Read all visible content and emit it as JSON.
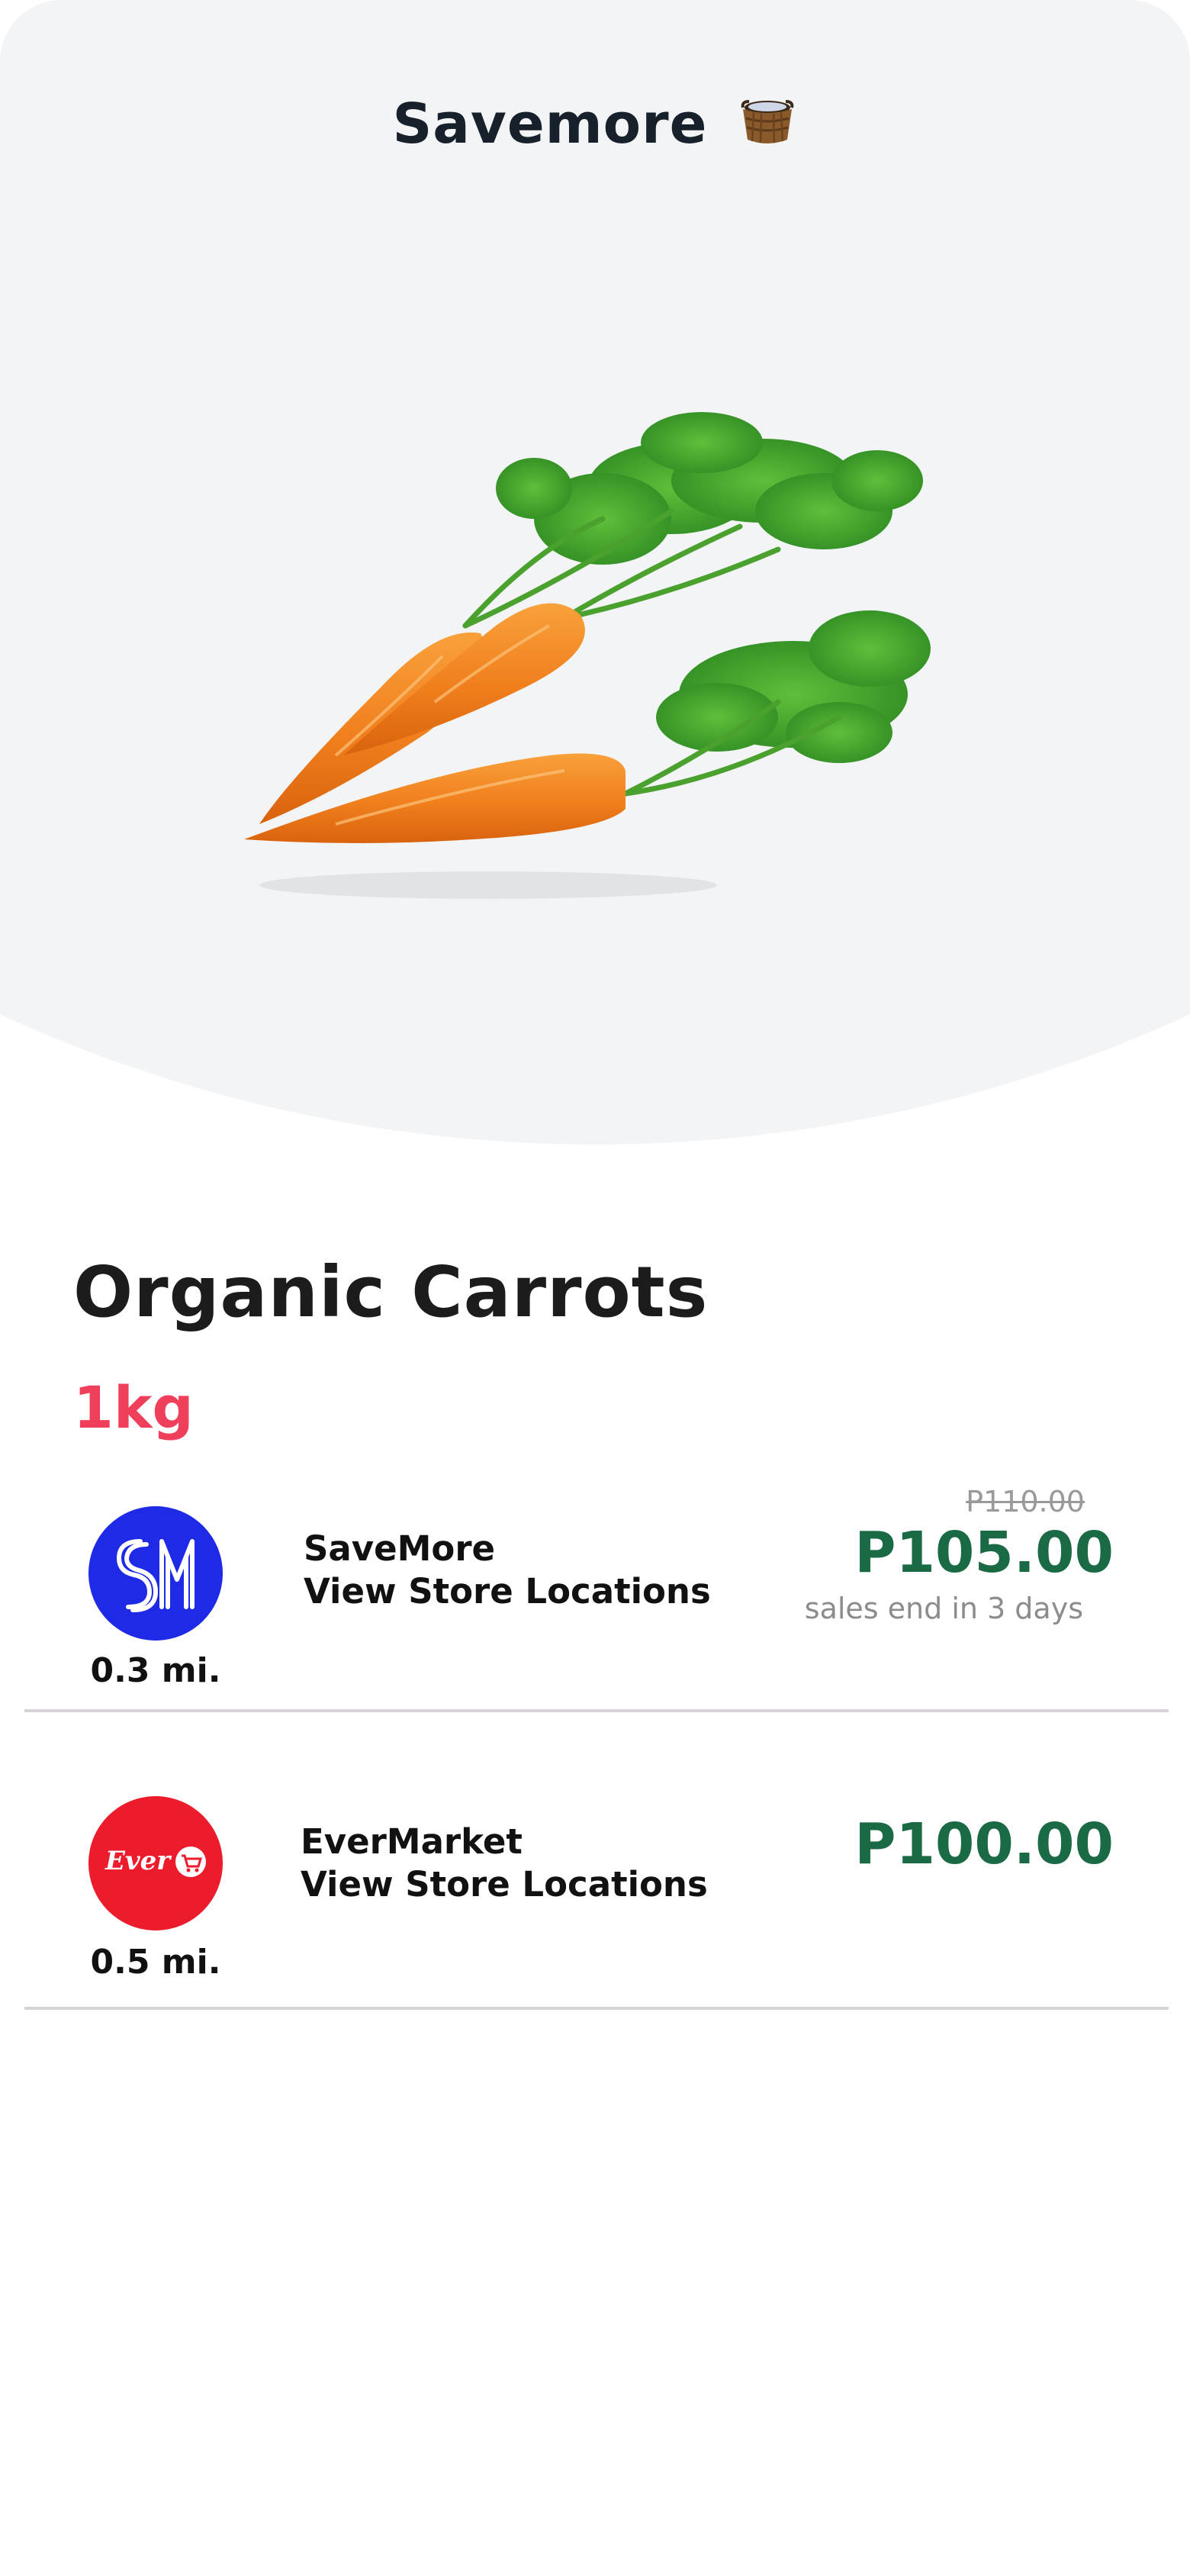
{
  "header": {
    "title": "Savemore",
    "icon": "basket-icon"
  },
  "product": {
    "name": "Organic Carrots",
    "weight": "1kg",
    "image": "carrots-image"
  },
  "stores": [
    {
      "name": "SaveMore",
      "link_label": "View Store Locations",
      "distance": "0.3 mi.",
      "original_price": "P110.00",
      "price": "P105.00",
      "sale_note": "sales end in 3 days",
      "logo": "sm-logo",
      "logo_color": "#1f2ae6"
    },
    {
      "name": "EverMarket",
      "link_label": "View Store Locations",
      "distance": "0.5 mi.",
      "price": "P100.00",
      "logo": "ever-logo",
      "logo_color": "#ec1c2d"
    }
  ],
  "colors": {
    "price": "#1a6b45",
    "accent": "#ef3f5a",
    "hero_bg": "#f3f4f6"
  }
}
